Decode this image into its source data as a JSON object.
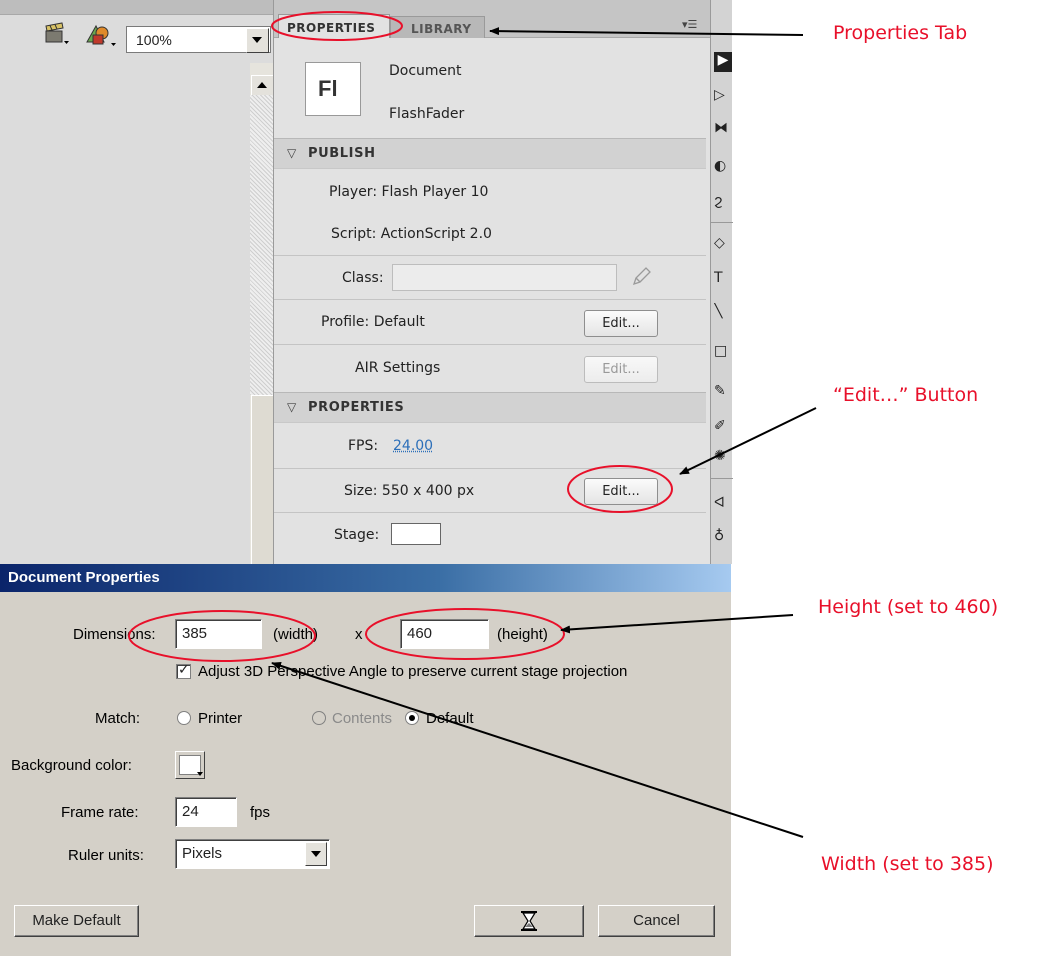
{
  "stage_toolbar": {
    "zoom_value": "100%",
    "icons": [
      "edit-scene-icon",
      "edit-symbols-icon"
    ]
  },
  "properties_panel": {
    "tabs": [
      {
        "label": "PROPERTIES",
        "active": true
      },
      {
        "label": "LIBRARY",
        "active": false
      }
    ],
    "doc_icon_text": "Fl",
    "doc_type": "Document",
    "doc_name": "FlashFader",
    "publish": {
      "header": "PUBLISH",
      "player": "Player: Flash Player 10",
      "script": "Script: ActionScript 2.0",
      "class_label": "Class:",
      "class_value": "",
      "profile": "Profile: Default",
      "profile_edit": "Edit...",
      "air_settings": "AIR Settings",
      "air_edit": "Edit..."
    },
    "properties": {
      "header": "PROPERTIES",
      "fps_label": "FPS:",
      "fps_value": "24.00",
      "size": "Size: 550 x 400 px",
      "size_edit": "Edit...",
      "stage_label": "Stage:",
      "stage_color": "#ffffff"
    }
  },
  "dialog": {
    "title": "Document Properties",
    "dimensions_label": "Dimensions:",
    "width_value": "385",
    "width_unit": "(width)",
    "times": "x",
    "height_value": "460",
    "height_unit": "(height)",
    "adjust_3d_label": "Adjust 3D Perspective Angle to preserve current stage projection",
    "adjust_3d_checked": true,
    "match_label": "Match:",
    "match_options": [
      {
        "label": "Printer",
        "selected": false,
        "enabled": true
      },
      {
        "label": "Contents",
        "selected": false,
        "enabled": false
      },
      {
        "label": "Default",
        "selected": true,
        "enabled": true
      }
    ],
    "bg_color_label": "Background color:",
    "bg_color": "#ffffff",
    "frame_rate_label": "Frame rate:",
    "frame_rate_value": "24",
    "fps_unit": "fps",
    "ruler_label": "Ruler units:",
    "ruler_value": "Pixels",
    "make_default": "Make Default",
    "ok_label": "",
    "cancel": "Cancel"
  },
  "annotations": {
    "properties_tab": "Properties Tab",
    "edit_button": "“Edit…” Button",
    "height": "Height (set to 460)",
    "width": "Width (set to 385)",
    "color": "#e8102a"
  }
}
